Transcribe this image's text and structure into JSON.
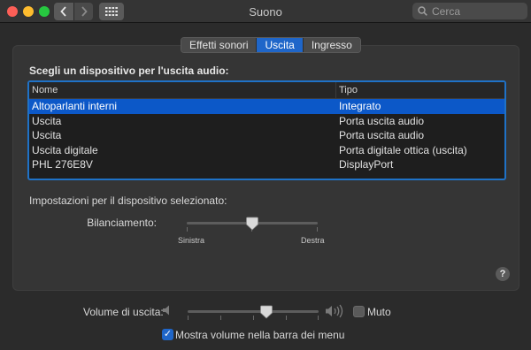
{
  "window": {
    "title": "Suono",
    "search_placeholder": "Cerca"
  },
  "tabs": [
    {
      "label": "Effetti sonori",
      "active": false
    },
    {
      "label": "Uscita",
      "active": true
    },
    {
      "label": "Ingresso",
      "active": false
    }
  ],
  "output": {
    "section_title": "Scegli un dispositivo per l'uscita audio:",
    "columns": [
      "Nome",
      "Tipo"
    ],
    "devices": [
      {
        "name": "Altoparlanti interni",
        "type": "Integrato",
        "selected": true
      },
      {
        "name": "Uscita",
        "type": "Porta uscita audio",
        "selected": false
      },
      {
        "name": "Uscita",
        "type": "Porta uscita audio",
        "selected": false
      },
      {
        "name": "Uscita digitale",
        "type": "Porta digitale ottica (uscita)",
        "selected": false
      },
      {
        "name": "PHL 276E8V",
        "type": "DisplayPort",
        "selected": false
      }
    ],
    "settings_label": "Impostazioni per il dispositivo selezionato:",
    "balance": {
      "label": "Bilanciamento:",
      "left_label": "Sinistra",
      "right_label": "Destra",
      "value": 0.5
    }
  },
  "volume": {
    "label": "Volume di uscita:",
    "value": 0.6,
    "mute_label": "Muto",
    "muted": false
  },
  "menubar_option": {
    "label": "Mostra volume nella barra dei menu",
    "checked": true
  },
  "icons": {
    "back": "chevron-left-icon",
    "forward": "chevron-right-icon",
    "grid": "grid-icon",
    "search": "search-icon",
    "help": "question-icon",
    "speaker_low": "speaker-low-icon",
    "speaker_high": "speaker-high-icon",
    "checkmark": "checkmark-icon"
  },
  "colors": {
    "accent": "#1f66c9",
    "selection": "#0c58c8",
    "close": "#fd5f57",
    "minimize": "#febc2e",
    "zoom": "#27c840"
  },
  "help_symbol": "?",
  "checkmark_symbol": "✓"
}
